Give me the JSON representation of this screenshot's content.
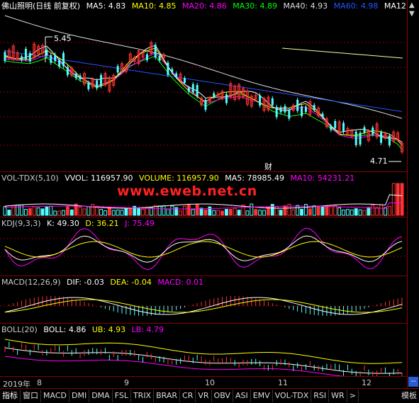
{
  "main": {
    "title": "佛山照明(日线 前复权)",
    "ma": [
      {
        "label": "MA5: 4.83",
        "color": "#ffffff"
      },
      {
        "label": "MA10: 4.85",
        "color": "#ffff00"
      },
      {
        "label": "MA20: 4.86",
        "color": "#ff00ff"
      },
      {
        "label": "MA30: 4.89",
        "color": "#00ff00"
      },
      {
        "label": "MA40: 4.93",
        "color": "#dddddd"
      },
      {
        "label": "MA60: 4.98",
        "color": "#2255ff"
      },
      {
        "label": "MA12",
        "color": "#ffffff"
      }
    ],
    "high_label": "5.45",
    "low_label": "4.71",
    "cai_label": "财"
  },
  "vol": {
    "title": "VOL-TDX(5,10)",
    "vvol": "VVOL: 116957.90",
    "volume": "VOLUME: 116957.90",
    "ma5": "MA5: 78985.49",
    "ma10": "MA10: 54231.21"
  },
  "watermark": "www.eweb.net.cn",
  "kdj": {
    "title": "KDJ(9,3,3)",
    "k": "K: 49.30",
    "d": "D: 36.21",
    "j": "J: 75.49"
  },
  "macd": {
    "title": "MACD(12,26,9)",
    "dif": "DIF: -0.03",
    "dea": "DEA: -0.04",
    "macd": "MACD: 0.01"
  },
  "boll": {
    "title": "BOLL(20)",
    "boll": "BOLL: 4.86",
    "ub": "UB: 4.93",
    "lb": "LB: 4.79"
  },
  "dates": {
    "year": "2019年",
    "m8": "8",
    "m9": "9",
    "m10": "10",
    "m11": "11",
    "m12": "12"
  },
  "tabs": [
    "指标",
    "窗口",
    "MACD",
    "DMI",
    "DMA",
    "FSL",
    "TRIX",
    "BRAR",
    "CR",
    "VR",
    "OBV",
    "ASI",
    "EMV",
    "VOL-TDX",
    "RSI",
    "WR",
    ">"
  ],
  "template_label": "模板",
  "right_controls": {
    "up": "▲",
    "down": "▼",
    "dash": "--"
  },
  "colors": {
    "up": "#ff3232",
    "down": "#54fcfc",
    "grid": "#8a0000",
    "text": "#cccccc"
  }
}
